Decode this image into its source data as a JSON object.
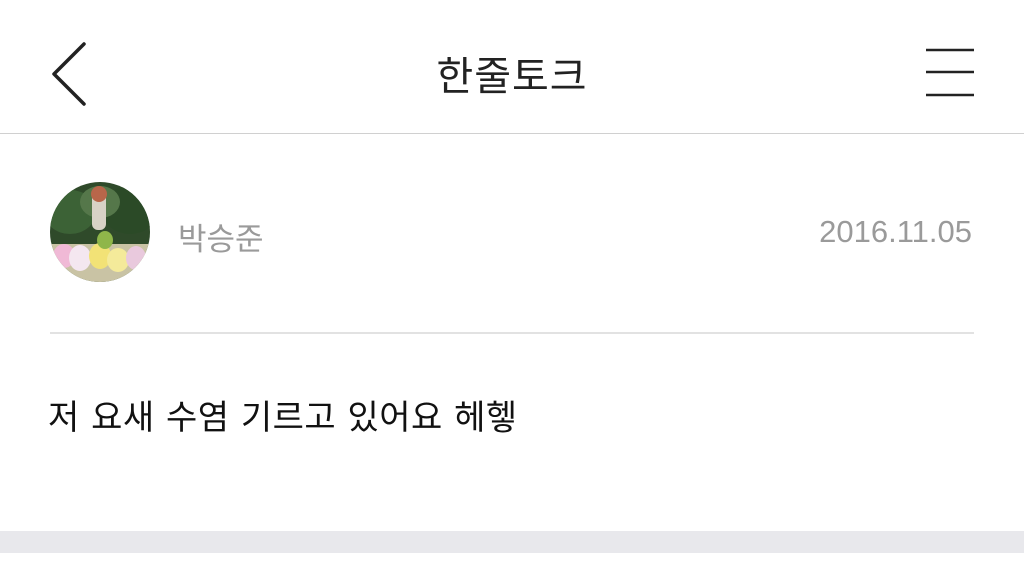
{
  "header": {
    "title": "한줄토크",
    "back_icon": "chevron-left-icon",
    "menu_icon": "hamburger-menu-icon"
  },
  "post": {
    "author": "박승준",
    "date": "2016.11.05",
    "body": "저 요새 수염 기르고 있어요 헤헿"
  },
  "colors": {
    "header_border": "#d0d0d0",
    "meta_text": "#9a9a9a",
    "body_text": "#111111",
    "footer_band": "#e8e8ec"
  }
}
